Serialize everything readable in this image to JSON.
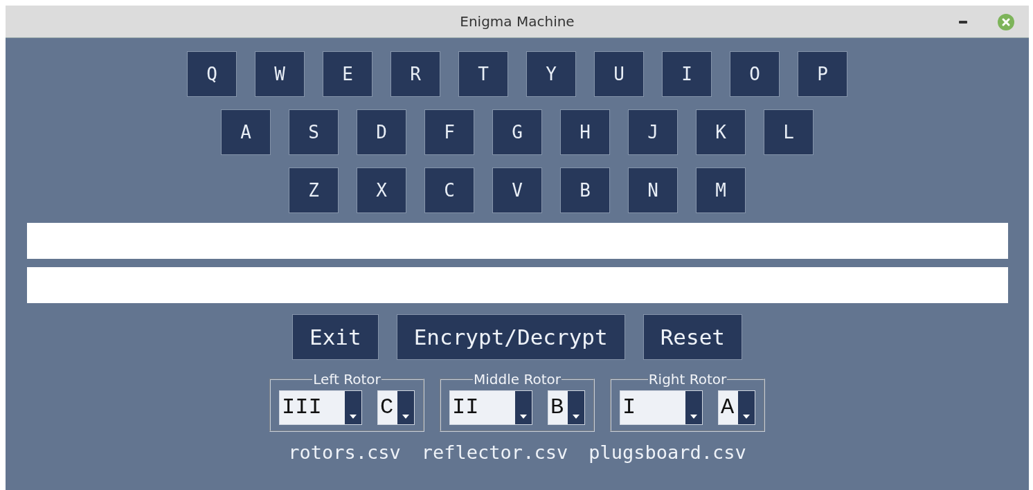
{
  "window": {
    "title": "Enigma Machine"
  },
  "keyboard": {
    "rows": [
      [
        "Q",
        "W",
        "E",
        "R",
        "T",
        "Y",
        "U",
        "I",
        "O",
        "P"
      ],
      [
        "A",
        "S",
        "D",
        "F",
        "G",
        "H",
        "J",
        "K",
        "L"
      ],
      [
        "Z",
        "X",
        "C",
        "V",
        "B",
        "N",
        "M"
      ]
    ]
  },
  "buttons": [
    "Exit",
    "Encrypt/Decrypt",
    "Reset"
  ],
  "rotors": [
    {
      "label": "Left Rotor",
      "rotor": "III",
      "position": "C"
    },
    {
      "label": "Middle Rotor",
      "rotor": "II",
      "position": "B"
    },
    {
      "label": "Right Rotor",
      "rotor": "I",
      "position": "A"
    }
  ],
  "files": [
    "rotors.csv",
    "reflector.csv",
    "plugsboard.csv"
  ]
}
